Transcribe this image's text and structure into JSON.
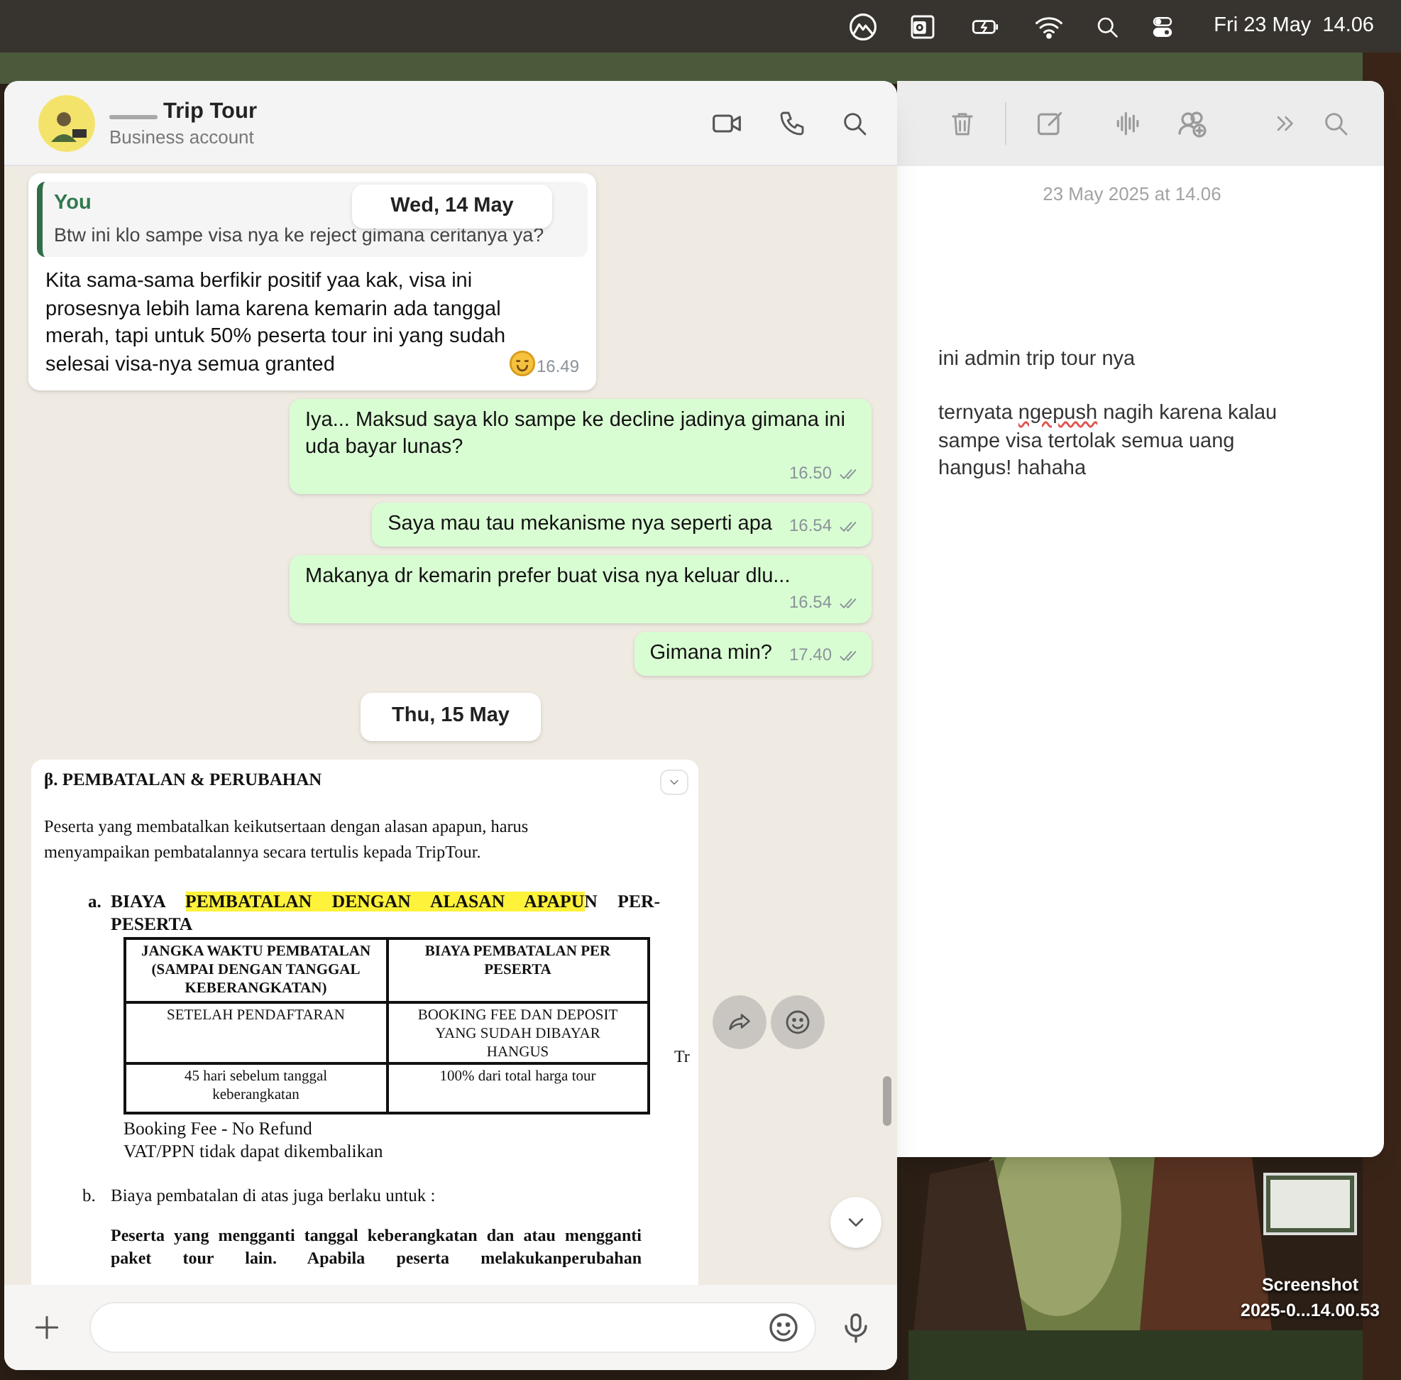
{
  "menu_bar": {
    "clock": "Fri 23 May  14.06"
  },
  "chat_window": {
    "contact": {
      "name": "Trip Tour",
      "subtitle": "Business account"
    },
    "sticky_date": "Wed, 14 May",
    "messages": [
      {
        "kind": "incoming",
        "quote": {
          "author": "You",
          "text": "Btw ini klo sampe visa nya ke reject gimana ceritanya ya?"
        },
        "text": "Kita sama-sama berfikir positif yaa kak, visa ini prosesnya lebih lama karena kemarin ada tanggal merah, tapi untuk 50% peserta tour ini yang sudah selesai visa-nya semua granted",
        "time": "16.49"
      },
      {
        "kind": "outgoing",
        "text": "Iya... Maksud saya klo sampe ke decline jadinya gimana ini uda bayar lunas?",
        "time": "16.50"
      },
      {
        "kind": "outgoing",
        "text": "Saya mau tau mekanisme nya seperti apa",
        "time": "16.54"
      },
      {
        "kind": "outgoing",
        "text": "Makanya dr kemarin prefer buat visa nya keluar dlu...",
        "time": "16.54"
      },
      {
        "kind": "outgoing",
        "text": "Gimana min?",
        "time": "17.40"
      },
      {
        "kind": "date",
        "text": "Thu, 15 May"
      },
      {
        "kind": "document",
        "heading": "β. PEMBATALAN & PERUBAHAN",
        "intro": "Peserta yang membatalkan keikutsertaan dengan alasan apapun, harus menyampaikan pembatalannya secara tertulis kepada TripTour.",
        "section_a": {
          "marker": "a.",
          "title": [
            {
              "text": "BIAYA ",
              "highlighted": false
            },
            {
              "text": "PEMBATALAN DENGAN ALASAN APAPU",
              "highlighted": true
            },
            {
              "text": "N PER-PESERTA",
              "highlighted": false
            }
          ]
        },
        "table": {
          "columns": [
            "JANGKA WAKTU PEMBATALAN (SAMPAI DENGAN TANGGAL KEBERANGKATAN)",
            "BIAYA PEMBATALAN PER PESERTA"
          ],
          "rows": [
            [
              "SETELAH PENDAFTARAN",
              "BOOKING FEE DAN DEPOSIT YANG SUDAH DIBAYAR HANGUS"
            ],
            [
              "45 hari sebelum tanggal keberangkatan",
              "100% dari total harga tour"
            ]
          ]
        },
        "notes": [
          "Booking Fee - No Refund",
          "VAT/PPN tidak dapat dikembalikan"
        ],
        "section_b": {
          "marker": "b.",
          "text": "Biaya pembatalan di atas juga berlaku untuk :"
        },
        "bold_paragraph": "Peserta yang mengganti tanggal keberangkatan dan atau mengganti paket tour lain. Apabila peserta melakukanperubahan",
        "side_text": "Tr"
      }
    ]
  },
  "notes_window": {
    "timestamp": "23 May 2025 at 14.06",
    "paragraphs": [
      [
        {
          "text": "ini admin trip tour nya",
          "misspelled": false
        }
      ],
      [
        {
          "text": "ternyata ",
          "misspelled": false
        },
        {
          "text": "ngepush",
          "misspelled": true
        },
        {
          "text": " nagih karena kalau sampe visa tertolak semua uang hangus! hahaha",
          "misspelled": false
        }
      ]
    ]
  },
  "desktop_file": {
    "name_lines": [
      "Screenshot",
      "2025-0...14.00.53"
    ]
  }
}
